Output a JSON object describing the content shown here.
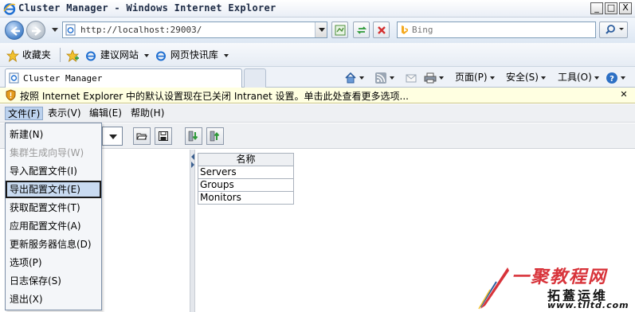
{
  "window": {
    "title": "Cluster Manager - Windows Internet Explorer",
    "minimize": "_",
    "maximize": "□",
    "close": "X"
  },
  "address_bar": {
    "url": "http://localhost:29003/",
    "search_placeholder": "Bing"
  },
  "favorites_bar": {
    "favorites_label": "收藏夹",
    "suggested_sites": "建议网站",
    "web_slice_gallery": "网页快讯库"
  },
  "tabs": [
    {
      "label": "Cluster Manager"
    }
  ],
  "command_bar": {
    "page": "页面(P)",
    "safety": "安全(S)",
    "tools": "工具(O)"
  },
  "info_bar": {
    "text": "按照 Internet Explorer 中的默认设置现在已关闭 Intranet 设置。单击此处查看更多选项..."
  },
  "app": {
    "menus": [
      {
        "label": "文件(F)"
      },
      {
        "label": "表示(V)"
      },
      {
        "label": "编辑(E)"
      },
      {
        "label": "帮助(H)"
      }
    ],
    "file_menu": [
      {
        "label": "新建(N)",
        "enabled": true,
        "selected": false
      },
      {
        "label": "集群生成向导(W)",
        "enabled": false,
        "selected": false
      },
      {
        "label": "导入配置文件(I)",
        "enabled": true,
        "selected": false
      },
      {
        "label": "导出配置文件(E)",
        "enabled": true,
        "selected": true
      },
      {
        "label": "获取配置文件(T)",
        "enabled": true,
        "selected": false
      },
      {
        "label": "应用配置文件(A)",
        "enabled": true,
        "selected": false
      },
      {
        "label": "更新服务器信息(D)",
        "enabled": true,
        "selected": false
      },
      {
        "label": "选项(P)",
        "enabled": true,
        "selected": false
      },
      {
        "label": "日志保存(S)",
        "enabled": true,
        "selected": false
      },
      {
        "label": "退出(X)",
        "enabled": true,
        "selected": false
      }
    ],
    "table": {
      "header": "名称",
      "rows": [
        "Servers",
        "Groups",
        "Monitors"
      ]
    }
  },
  "watermark": {
    "title": "一聚教程网",
    "subtitle": "拓蓋运维",
    "url": "www.tlltd.com"
  },
  "colors": {
    "accent": "#3f7cc6",
    "info_bar": "#ffffe1",
    "menu_open": "#bcd2ee",
    "selected_item": "#c9dbf1",
    "watermark_red": "#d8333a"
  }
}
